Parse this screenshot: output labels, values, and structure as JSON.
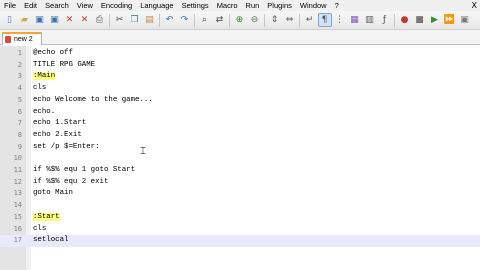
{
  "menu": [
    "File",
    "Edit",
    "Search",
    "View",
    "Encoding",
    "Language",
    "Settings",
    "Macro",
    "Run",
    "Plugins",
    "Window",
    "?"
  ],
  "window_close": "X",
  "toolbar_icons": [
    "new-file-icon",
    "open-file-icon",
    "save-icon",
    "save-all-icon",
    "close-icon",
    "close-all-icon",
    "print-icon",
    "cut-icon",
    "copy-icon",
    "paste-icon",
    "undo-icon",
    "redo-icon",
    "find-icon",
    "replace-icon",
    "zoom-in-icon",
    "zoom-out-icon",
    "sync-vertical-icon",
    "sync-horizontal-icon",
    "word-wrap-icon",
    "show-all-chars-icon",
    "indent-guide-icon",
    "user-defined-language-icon",
    "document-map-icon",
    "function-list-icon",
    "record-macro-icon",
    "stop-record-icon",
    "playback-icon",
    "run-macro-multiple-icon",
    "save-macro-icon"
  ],
  "tab": {
    "label": "new  2"
  },
  "editor": {
    "current_line": 17,
    "lines": [
      {
        "num": "1",
        "text": "@echo off"
      },
      {
        "num": "2",
        "text": "TITLE RPG GAME"
      },
      {
        "num": "3",
        "text": ":Main",
        "label": true
      },
      {
        "num": "4",
        "text": "cls"
      },
      {
        "num": "5",
        "text": "echo Welcome to the game..."
      },
      {
        "num": "6",
        "text": "echo."
      },
      {
        "num": "7",
        "text": "echo 1.Start"
      },
      {
        "num": "8",
        "text": "echo 2.Exit"
      },
      {
        "num": "9",
        "text": "set /p $=Enter:"
      },
      {
        "num": "10",
        "text": ""
      },
      {
        "num": "11",
        "text": "if %$% equ 1 goto Start"
      },
      {
        "num": "12",
        "text": "if %$% equ 2 exit"
      },
      {
        "num": "13",
        "text": "goto Main"
      },
      {
        "num": "14",
        "text": ""
      },
      {
        "num": "15",
        "text": ":Start",
        "label": true
      },
      {
        "num": "16",
        "text": "cls"
      },
      {
        "num": "17",
        "text": "setlocal"
      }
    ]
  },
  "colors": {
    "current_line": "#e8e8ff",
    "label_highlight": "#ffff80",
    "tab_accent": "#f3a33a",
    "variable": "#ff8000"
  }
}
